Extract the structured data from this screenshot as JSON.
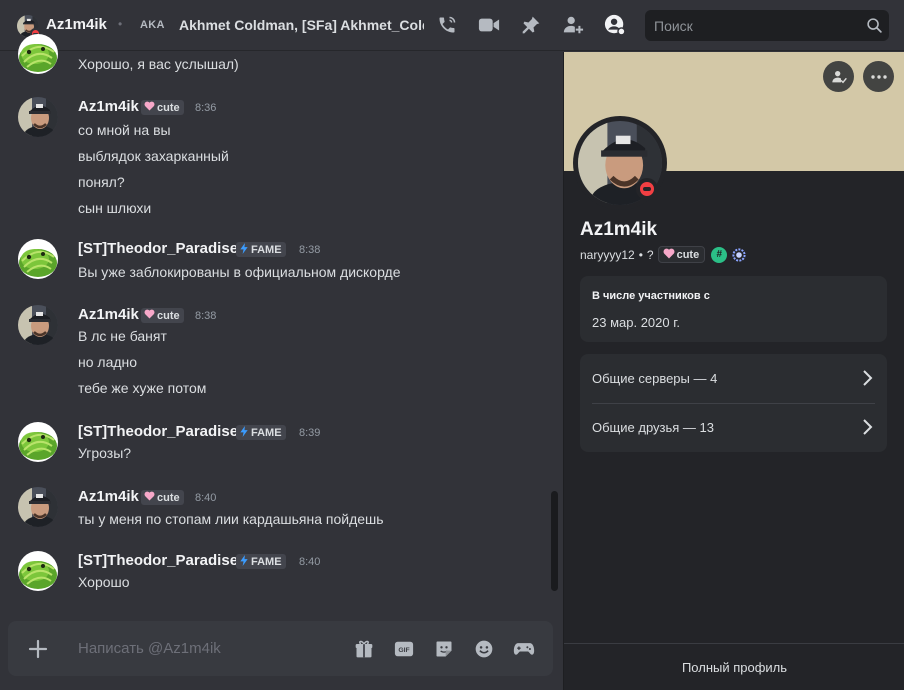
{
  "header": {
    "name": "Az1m4ik",
    "aka_label": "AKA",
    "aka_names": "Akhmet Coldman, [SFa] Akhmet_Coldman",
    "search_placeholder": "Поиск"
  },
  "messages": [
    {
      "kind": "continuation",
      "lines": [
        "Хорошо, я вас услышал)"
      ],
      "avatar": "lizard"
    },
    {
      "author": "Az1m4ik",
      "tag": "cute",
      "tag_icon": "heart-icon",
      "time": "8:36",
      "avatar": "man",
      "lines": [
        "со мной на вы",
        "выблядок захарканный",
        "понял?",
        "сын шлюхи"
      ]
    },
    {
      "author": "[ST]Theodor_Paradise",
      "tag": "FAME",
      "tag_icon": "lightning-icon",
      "time": "8:38",
      "avatar": "lizard",
      "lines": [
        "Вы уже заблокированы в официальном дискорде"
      ]
    },
    {
      "author": "Az1m4ik",
      "tag": "cute",
      "tag_icon": "heart-icon",
      "time": "8:38",
      "avatar": "man",
      "lines": [
        "В лс не банят",
        "но ладно",
        "тебе же хуже потом"
      ]
    },
    {
      "author": "[ST]Theodor_Paradise",
      "tag": "FAME",
      "tag_icon": "lightning-icon",
      "time": "8:39",
      "avatar": "lizard",
      "lines": [
        "Угрозы?"
      ]
    },
    {
      "author": "Az1m4ik",
      "tag": "cute",
      "tag_icon": "heart-icon",
      "time": "8:40",
      "avatar": "man",
      "lines": [
        "ты у меня по стопам лии кардашьяна пойдешь"
      ]
    },
    {
      "author": "[ST]Theodor_Paradise",
      "tag": "FAME",
      "tag_icon": "lightning-icon",
      "time": "8:40",
      "avatar": "lizard",
      "lines": [
        "Хорошо"
      ]
    }
  ],
  "composer": {
    "placeholder": "Написать @Az1m4ik",
    "gif_label": "GIF"
  },
  "profile": {
    "display_name": "Az1m4ik",
    "username": "narуууу12",
    "separator": "•",
    "pronoun": "?",
    "tag": "cute",
    "member_since_title": "В числе участников с",
    "member_since_date": "23 мар. 2020 г.",
    "mutual_servers": "Общие серверы — 4",
    "mutual_friends": "Общие друзья — 13",
    "full_profile": "Полный профиль"
  },
  "colors": {
    "background": "#323339",
    "panel": "#232428",
    "banner": "#d3c8a7",
    "dnd": "#f23f43",
    "fame_bolt": "#3b9cff",
    "heart": "#f7a8c9"
  }
}
